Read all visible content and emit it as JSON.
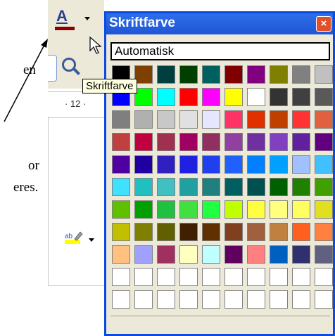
{
  "document": {
    "line1": "en",
    "line2": "or",
    "line3": "eres."
  },
  "toolbar": {
    "font_color_glyph": "A",
    "font_color_bar": "#8b0000",
    "ruler_number": "· 12 ·"
  },
  "tooltip": {
    "text": "Skriftfarve"
  },
  "popup": {
    "title": "Skriftfarve",
    "close_glyph": "×",
    "automatic_label": "Automatisk",
    "colors": [
      "#000000",
      "#7f3f00",
      "#003f3f",
      "#003f00",
      "#006060",
      "#800000",
      "#800080",
      "#808000",
      "#808080",
      "#c0c0c0",
      "#0000ff",
      "#00ff00",
      "#00ffff",
      "#ff0000",
      "#ff00ff",
      "#ffff00",
      "#ffffff",
      "#333333",
      "#404040",
      "#595959",
      "#7f7f7f",
      "#b0b0b0",
      "#c8c8c8",
      "#e0e0e0",
      "#e6e6ff",
      "#ff3366",
      "#e03000",
      "#c04000",
      "#ff3333",
      "#e06040",
      "#c04040",
      "#c0003f",
      "#a0304f",
      "#a00060",
      "#903060",
      "#9040a0",
      "#7030a0",
      "#8040c0",
      "#6020a0",
      "#600080",
      "#5000a0",
      "#2000a0",
      "#3020c0",
      "#2020e0",
      "#2040f0",
      "#2060ff",
      "#0080ff",
      "#00a0ff",
      "#a0c0ff",
      "#40c0ff",
      "#40e0ff",
      "#20c0c0",
      "#40c0c0",
      "#20a0a0",
      "#208080",
      "#006060",
      "#005050",
      "#006000",
      "#208000",
      "#40a000",
      "#60c000",
      "#00a000",
      "#20c040",
      "#40e040",
      "#20ff40",
      "#c0ff00",
      "#ffff40",
      "#ffff80",
      "#ffff60",
      "#e0e020",
      "#c0c000",
      "#808000",
      "#606000",
      "#402000",
      "#603000",
      "#804020",
      "#a06040",
      "#c08040",
      "#ff6020",
      "#ff8040",
      "#ffc080",
      "#a0a0ff",
      "#a03060",
      "#ffffc0",
      "#c0ffff",
      "#600060",
      "#ff8080",
      "#0060c0",
      "#303070",
      "#606080",
      "#8080c0",
      "#c0c0ff"
    ],
    "empty_count": 20
  }
}
